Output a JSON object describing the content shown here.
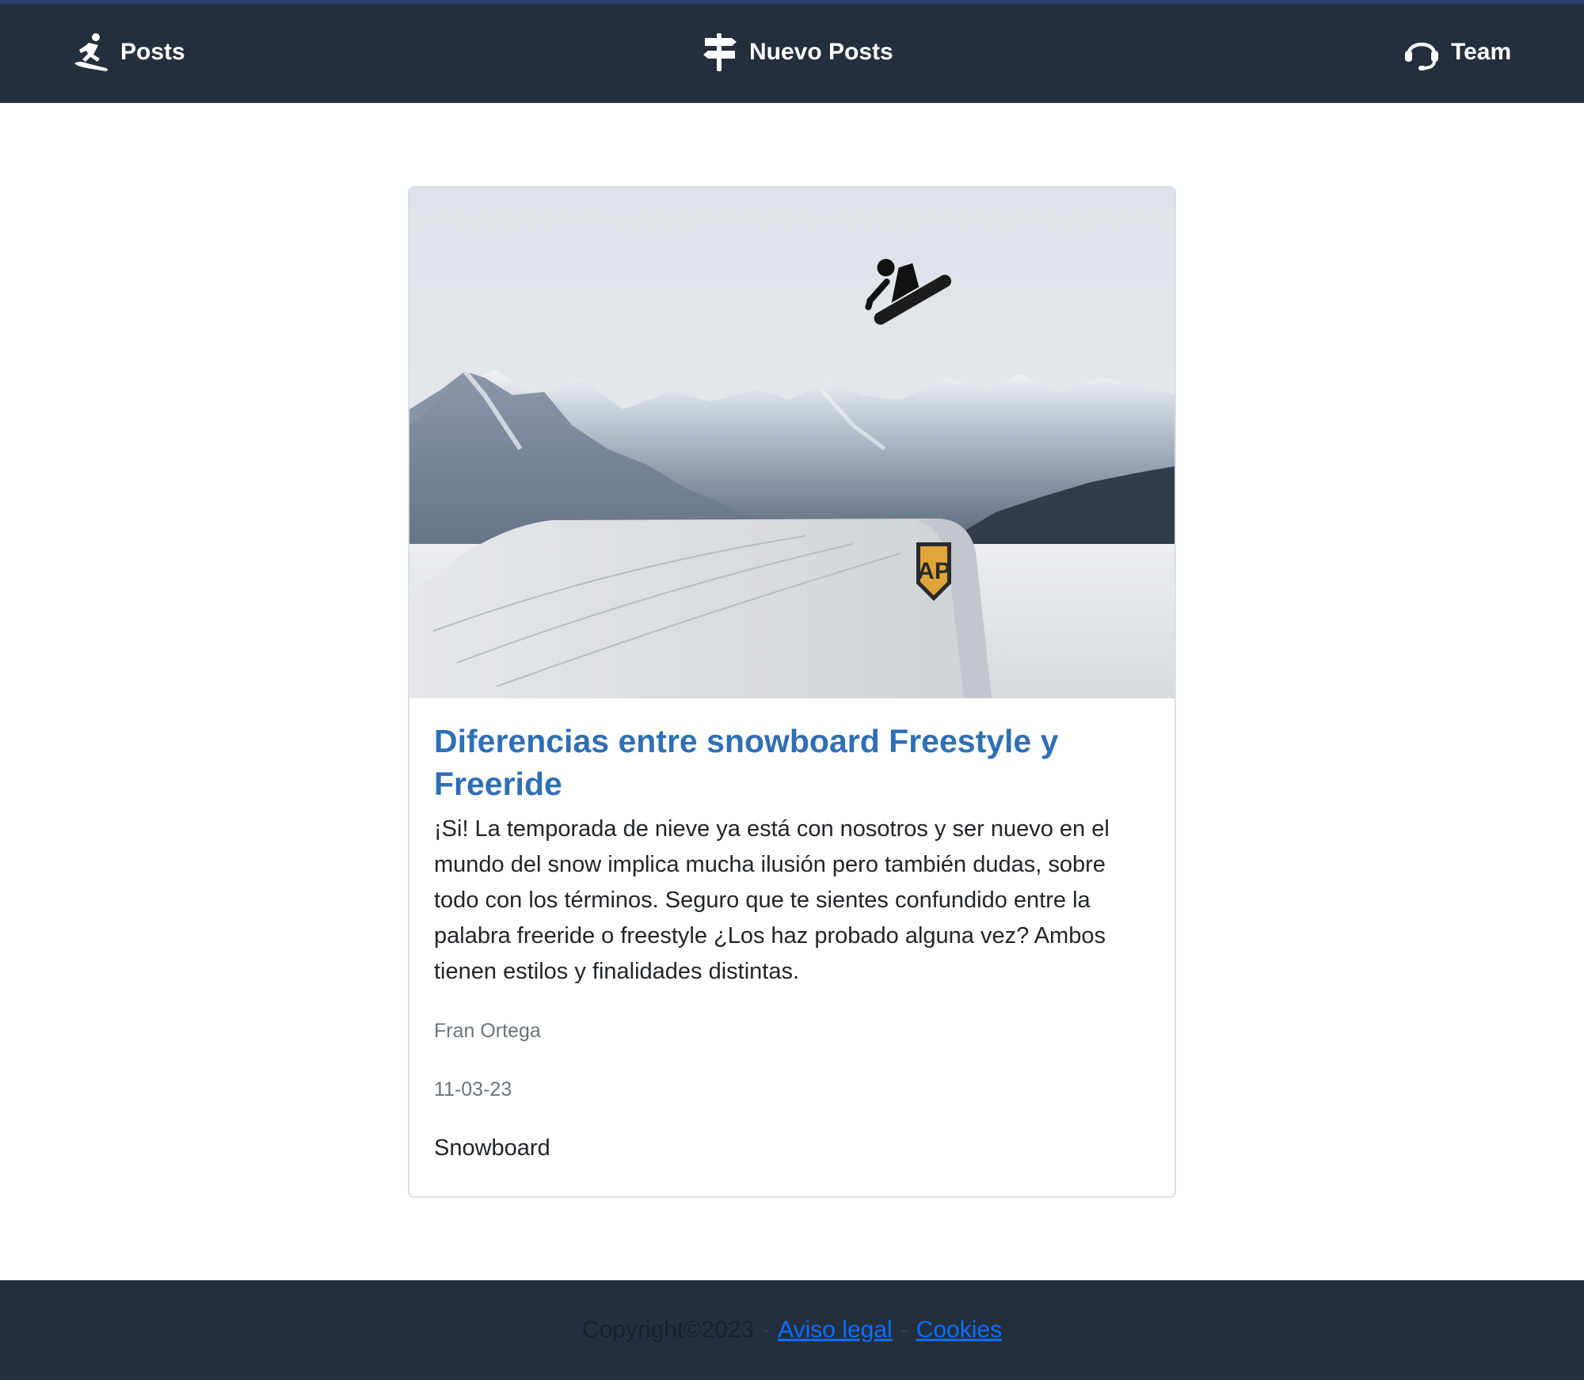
{
  "nav": {
    "posts": {
      "label": "Posts",
      "icon": "snowboarder-icon"
    },
    "nuevo": {
      "label": "Nuevo Posts",
      "icon": "signpost-icon"
    },
    "team": {
      "label": "Team",
      "icon": "headset-icon"
    }
  },
  "post": {
    "title": "Diferencias entre snowboard Freestyle y Freeride",
    "excerpt": "¡Si! La temporada de nieve ya está con nosotros y ser nuevo en el mundo del snow implica mucha ilusión pero también dudas, sobre todo con los términos. Seguro que te sientes confundido entre la palabra freeride o freestyle ¿Los haz probado alguna vez? Ambos tienen estilos y finalidades distintas.",
    "author": "Fran Ortega",
    "date": "11-03-23",
    "category": "Snowboard",
    "logo_text": "AP"
  },
  "footer": {
    "copyright": "Copyright©2023",
    "separator": "-",
    "legal": "Aviso legal",
    "cookies": "Cookies"
  },
  "colors": {
    "nav_bg": "#242f3d",
    "accent": "#2f6fb5",
    "link": "#0d6efd"
  }
}
